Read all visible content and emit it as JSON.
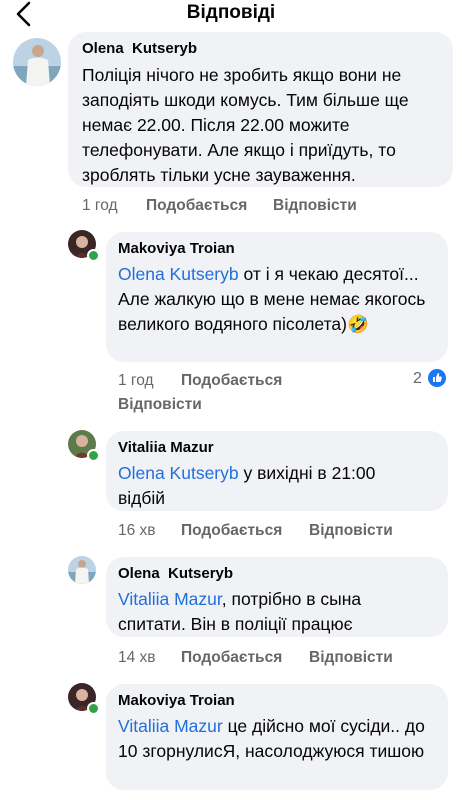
{
  "header": {
    "title": "Відповіді",
    "back_icon": "chevron-left-icon"
  },
  "comments": [
    {
      "author": "Olena  Kutseryb",
      "text": "Поліція нічого не зробить якщо вони не заподіять шкоди комусь. Тим більше ще немає 22.00. Після 22.00 можите телефонувати. Але якщо і приїдуть, то зроблять тільки усне зауваження.",
      "time": "1 год",
      "like": "Подобається",
      "reply": "Відповісти"
    },
    {
      "author": "Makoviya Troian",
      "mention": "Olena  Kutseryb",
      "text": " от і  я чекаю десятої... Але жалкую що в мене немає якогось великого водяного пісолета)",
      "emoji": "🤣",
      "time": "1 год",
      "like": "Подобається",
      "reply": "Відповісти",
      "reactions": "2"
    },
    {
      "author": "Vitaliia Mazur",
      "mention": "Olena  Kutseryb",
      "text": " у вихідні в 21:00 відбій",
      "time": "16 хв",
      "like": "Подобається",
      "reply": "Відповісти"
    },
    {
      "author": "Olena  Kutseryb",
      "mention": "Vitaliia Mazur",
      "text": ", потрібно в сына спитати. Він в поліції працює",
      "time": "14 хв",
      "like": "Подобається",
      "reply": "Відповісти"
    },
    {
      "author": "Makoviya Troian",
      "mention": "Vitaliia Mazur",
      "text": " це дійсно мої сусіди.. до 10 згорнулисЯ, насолоджуюся тишою"
    }
  ],
  "colors": {
    "link": "#216fdb",
    "bubble": "#f0f2f5",
    "meta": "#65676b",
    "online": "#31a24c",
    "like": "#1877f2"
  }
}
